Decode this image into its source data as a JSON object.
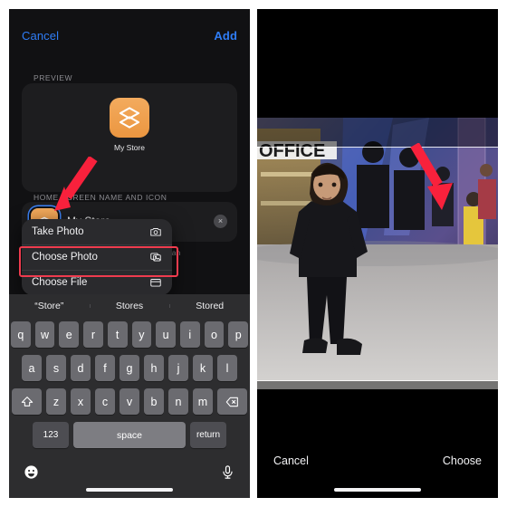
{
  "left_panel": {
    "nav": {
      "cancel_label": "Cancel",
      "add_label": "Add"
    },
    "preview": {
      "section_label": "PREVIEW",
      "app_name": "My Store",
      "icon_name": "layers-icon",
      "icon_color": "#eb9640"
    },
    "home_screen_section": {
      "section_label": "HOME SCREEN NAME AND ICON",
      "field_value": "My Store",
      "clear_button_glyph": "×",
      "helper_text": "creen so you can"
    },
    "context_menu": {
      "items": [
        {
          "label": "Take Photo",
          "icon": "camera-icon"
        },
        {
          "label": "Choose Photo",
          "icon": "photo-stack-icon"
        },
        {
          "label": "Choose File",
          "icon": "folder-icon"
        }
      ],
      "highlighted_index": 1,
      "highlight_color": "#ef3b4e"
    },
    "keyboard": {
      "predictions": [
        "“Store”",
        "Stores",
        "Stored"
      ],
      "row1": [
        "q",
        "w",
        "e",
        "r",
        "t",
        "y",
        "u",
        "i",
        "o",
        "p"
      ],
      "row2": [
        "a",
        "s",
        "d",
        "f",
        "g",
        "h",
        "j",
        "k",
        "l"
      ],
      "row3": [
        "z",
        "x",
        "c",
        "v",
        "b",
        "n",
        "m"
      ],
      "shift_key": "shift-icon",
      "backspace_key": "backspace-icon",
      "numbers_key": "123",
      "space_key": "space",
      "return_key": "return",
      "emoji_key": "emoji-icon",
      "dictation_key": "microphone-icon"
    },
    "annotation": {
      "arrow_color": "#f8213c",
      "points_at": "home-screen-icon"
    }
  },
  "right_panel": {
    "photo": {
      "description": "Boy standing in a shopping mall with people and OFFICE store sign",
      "sign_text": "OFFICE"
    },
    "toolbar": {
      "cancel_label": "Cancel",
      "choose_label": "Choose"
    },
    "annotation": {
      "arrow_color": "#f8213c",
      "points_at": "choose-button"
    }
  },
  "accent_colors": {
    "blue": "#2f7df6",
    "orange": "#eb9640",
    "red": "#f8213c"
  }
}
